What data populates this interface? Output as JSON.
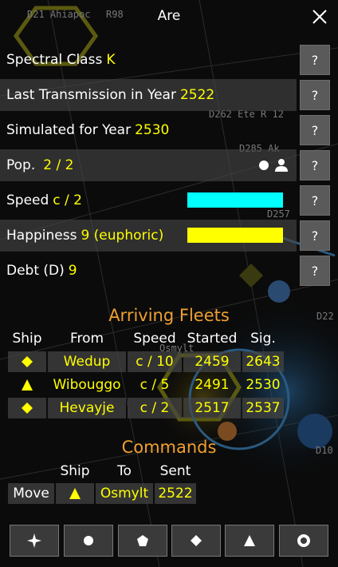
{
  "header": {
    "title": "Are"
  },
  "stats": {
    "spectral": {
      "label": "Spectral Class",
      "value": "K"
    },
    "transmission": {
      "label": "Last Transmission in Year",
      "value": "2522"
    },
    "simulated": {
      "label": "Simulated for Year",
      "value": "2530"
    },
    "pop": {
      "label": "Pop.",
      "value": "2 / 2"
    },
    "speed": {
      "label": "Speed",
      "value": "c / 2",
      "bar_color": "#00ffff",
      "level": 1.0
    },
    "happiness": {
      "label": "Happiness",
      "value": "9 (euphoric)",
      "bar_color": "#ffff00",
      "level": 1.0
    },
    "debt": {
      "label": "Debt (D)",
      "value": "9"
    },
    "help_label": "?"
  },
  "fleets": {
    "heading": "Arriving Fleets",
    "columns": [
      "Ship",
      "From",
      "Speed",
      "Started",
      "Sig."
    ],
    "rows": [
      {
        "ship_icon": "diamond",
        "from": "Wedup",
        "speed": "c / 10",
        "started": "2459",
        "sig": "2643"
      },
      {
        "ship_icon": "triangle",
        "from": "Wibouggo",
        "speed": "c / 5",
        "started": "2491",
        "sig": "2530"
      },
      {
        "ship_icon": "diamond",
        "from": "Hevayje",
        "speed": "c / 2",
        "started": "2517",
        "sig": "2537"
      }
    ]
  },
  "commands": {
    "heading": "Commands",
    "columns": [
      "Ship",
      "To",
      "Sent"
    ],
    "rows": [
      {
        "action": "Move",
        "ship_icon": "triangle",
        "to": "Osmylt",
        "sent": "2522"
      }
    ]
  },
  "map_labels": {
    "l1": "D21 Ahiapoc",
    "l2": "R98",
    "l3": "D262 Ete R 12",
    "l4": "D285 Ak",
    "l5": "D257",
    "l6": "D22",
    "l7": "Osmylt",
    "l8": "D10"
  },
  "toolbar": {
    "buttons": [
      "star-icon",
      "circle-icon",
      "pentagon-icon",
      "diamond-icon",
      "triangle-icon",
      "ring-icon"
    ]
  },
  "colors": {
    "accent_yellow": "#ffff00",
    "section_orange": "#f0a030",
    "speed_cyan": "#00ffff"
  }
}
